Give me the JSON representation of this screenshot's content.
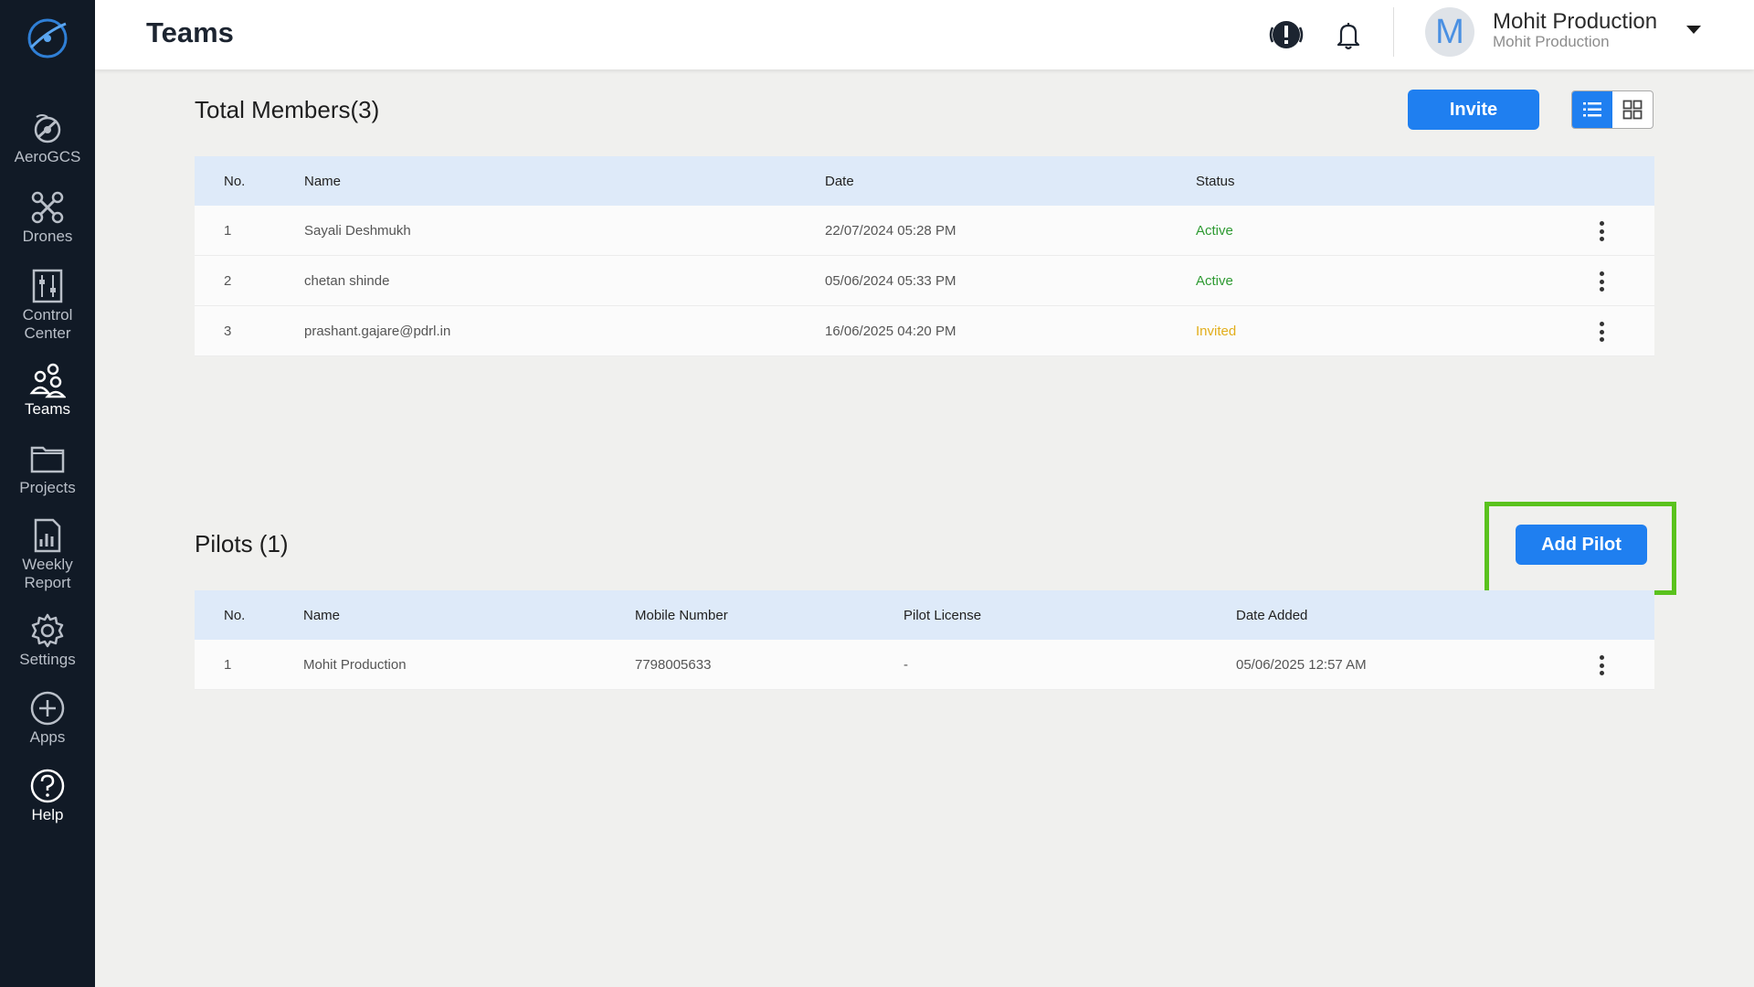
{
  "header": {
    "title": "Teams",
    "user_name": "Mohit Production",
    "user_org": "Mohit Production",
    "avatar_letter": "M"
  },
  "sidebar": {
    "items": [
      {
        "label": "AeroGCS",
        "icon": "aerogcs-icon"
      },
      {
        "label": "Drones",
        "icon": "drone-icon"
      },
      {
        "label": "Control\nCenter",
        "icon": "control-center-icon"
      },
      {
        "label": "Teams",
        "icon": "teams-icon",
        "active": true
      },
      {
        "label": "Projects",
        "icon": "folder-icon"
      },
      {
        "label": "Weekly\nReport",
        "icon": "report-icon"
      },
      {
        "label": "Settings",
        "icon": "gear-icon"
      },
      {
        "label": "Apps",
        "icon": "plus-circle-icon"
      },
      {
        "label": "Help",
        "icon": "help-icon"
      }
    ]
  },
  "members": {
    "title": "Total Members(3)",
    "invite_label": "Invite",
    "columns": [
      "No.",
      "Name",
      "Date",
      "Status"
    ],
    "rows": [
      {
        "no": "1",
        "name": "Sayali Deshmukh",
        "date": "22/07/2024 05:28 PM",
        "status": "Active"
      },
      {
        "no": "2",
        "name": "chetan shinde",
        "date": "05/06/2024 05:33 PM",
        "status": "Active"
      },
      {
        "no": "3",
        "name": "prashant.gajare@pdrl.in",
        "date": "16/06/2025 04:20 PM",
        "status": "Invited"
      }
    ]
  },
  "pilots": {
    "title": "Pilots (1)",
    "add_label": "Add Pilot",
    "columns": [
      "No.",
      "Name",
      "Mobile Number",
      "Pilot License",
      "Date Added"
    ],
    "rows": [
      {
        "no": "1",
        "name": "Mohit Production",
        "mobile": "7798005633",
        "license": "-",
        "date_added": "05/06/2025 12:57 AM"
      }
    ]
  },
  "colors": {
    "accent": "#1f7ff0",
    "sidebar_bg": "#111a26",
    "active_status": "#2e9a32",
    "invited_status": "#e2ae1b",
    "highlight": "#5ac21d"
  }
}
